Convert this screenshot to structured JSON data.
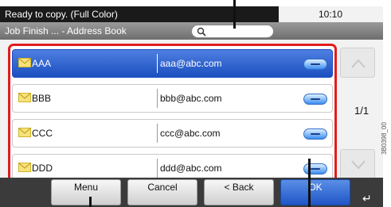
{
  "status": {
    "text": "Ready to copy. (Full Color)",
    "time": "10:10"
  },
  "breadcrumb": {
    "text": "Job Finish ... - Address Book"
  },
  "search": {
    "icon": "search-icon",
    "value": ""
  },
  "address_list": {
    "rows": [
      {
        "name": "AAA",
        "email": "aaa@abc.com",
        "selected": true
      },
      {
        "name": "BBB",
        "email": "bbb@abc.com",
        "selected": false
      },
      {
        "name": "CCC",
        "email": "ccc@abc.com",
        "selected": false
      },
      {
        "name": "DDD",
        "email": "ddd@abc.com",
        "selected": false
      }
    ]
  },
  "pager": {
    "label": "1/1"
  },
  "buttons": {
    "menu": "Menu",
    "cancel": "Cancel",
    "back": "< Back",
    "ok": "OK"
  },
  "image_id": "3B0398_00",
  "colors": {
    "highlight": "#e21c1c",
    "selected_row": "#1b4fc0",
    "status_bar": "#1a1a1a"
  }
}
